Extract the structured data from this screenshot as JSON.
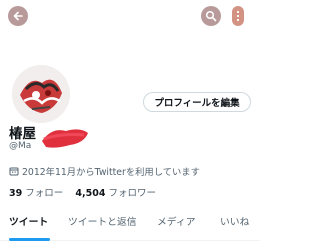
{
  "profile": {
    "name": "椿屋",
    "handle": "@Ma",
    "joined": "2012年11月からTwitterを利用しています",
    "following_count": "39",
    "following_label": "フォロー",
    "followers_count": "4,504",
    "followers_label": "フォロワー",
    "edit_label": "プロフィールを編集"
  },
  "tabs": [
    {
      "label": "ツイート"
    },
    {
      "label": "ツイートと返信"
    },
    {
      "label": "メディア"
    },
    {
      "label": "いいね"
    }
  ],
  "colors": {
    "accent": "#1d9bf0",
    "header_button": "#a07878"
  },
  "icons": [
    "back-arrow-icon",
    "search-icon",
    "more-icon",
    "calendar-icon"
  ]
}
